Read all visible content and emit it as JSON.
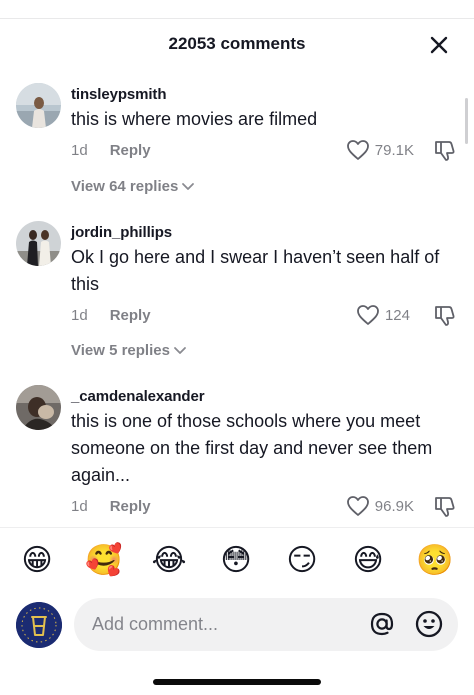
{
  "header": {
    "title": "22053 comments",
    "close_icon": "close-icon"
  },
  "comments": [
    {
      "username": "tinsleypsmith",
      "text": "this is where movies are filmed",
      "time": "1d",
      "reply_label": "Reply",
      "likes": "79.1K",
      "view_replies": "View 64 replies"
    },
    {
      "username": "jordin_phillips",
      "text": "Ok I go here and I swear I haven’t seen half of this",
      "time": "1d",
      "reply_label": "Reply",
      "likes": "124",
      "view_replies": "View 5 replies"
    },
    {
      "username": "_camdenalexander",
      "text": "this is one of those schools where you meet someone on the first day and never see them again...",
      "time": "1d",
      "reply_label": "Reply",
      "likes": "96.9K"
    }
  ],
  "emoji_bar": [
    "😁",
    "🥰",
    "😂",
    "😳",
    "😏",
    "😅",
    "🥺"
  ],
  "composer": {
    "placeholder": "Add comment..."
  },
  "colors": {
    "text_primary": "#161823",
    "text_secondary": "#8a8b91",
    "input_bg": "#f1f1f2"
  }
}
